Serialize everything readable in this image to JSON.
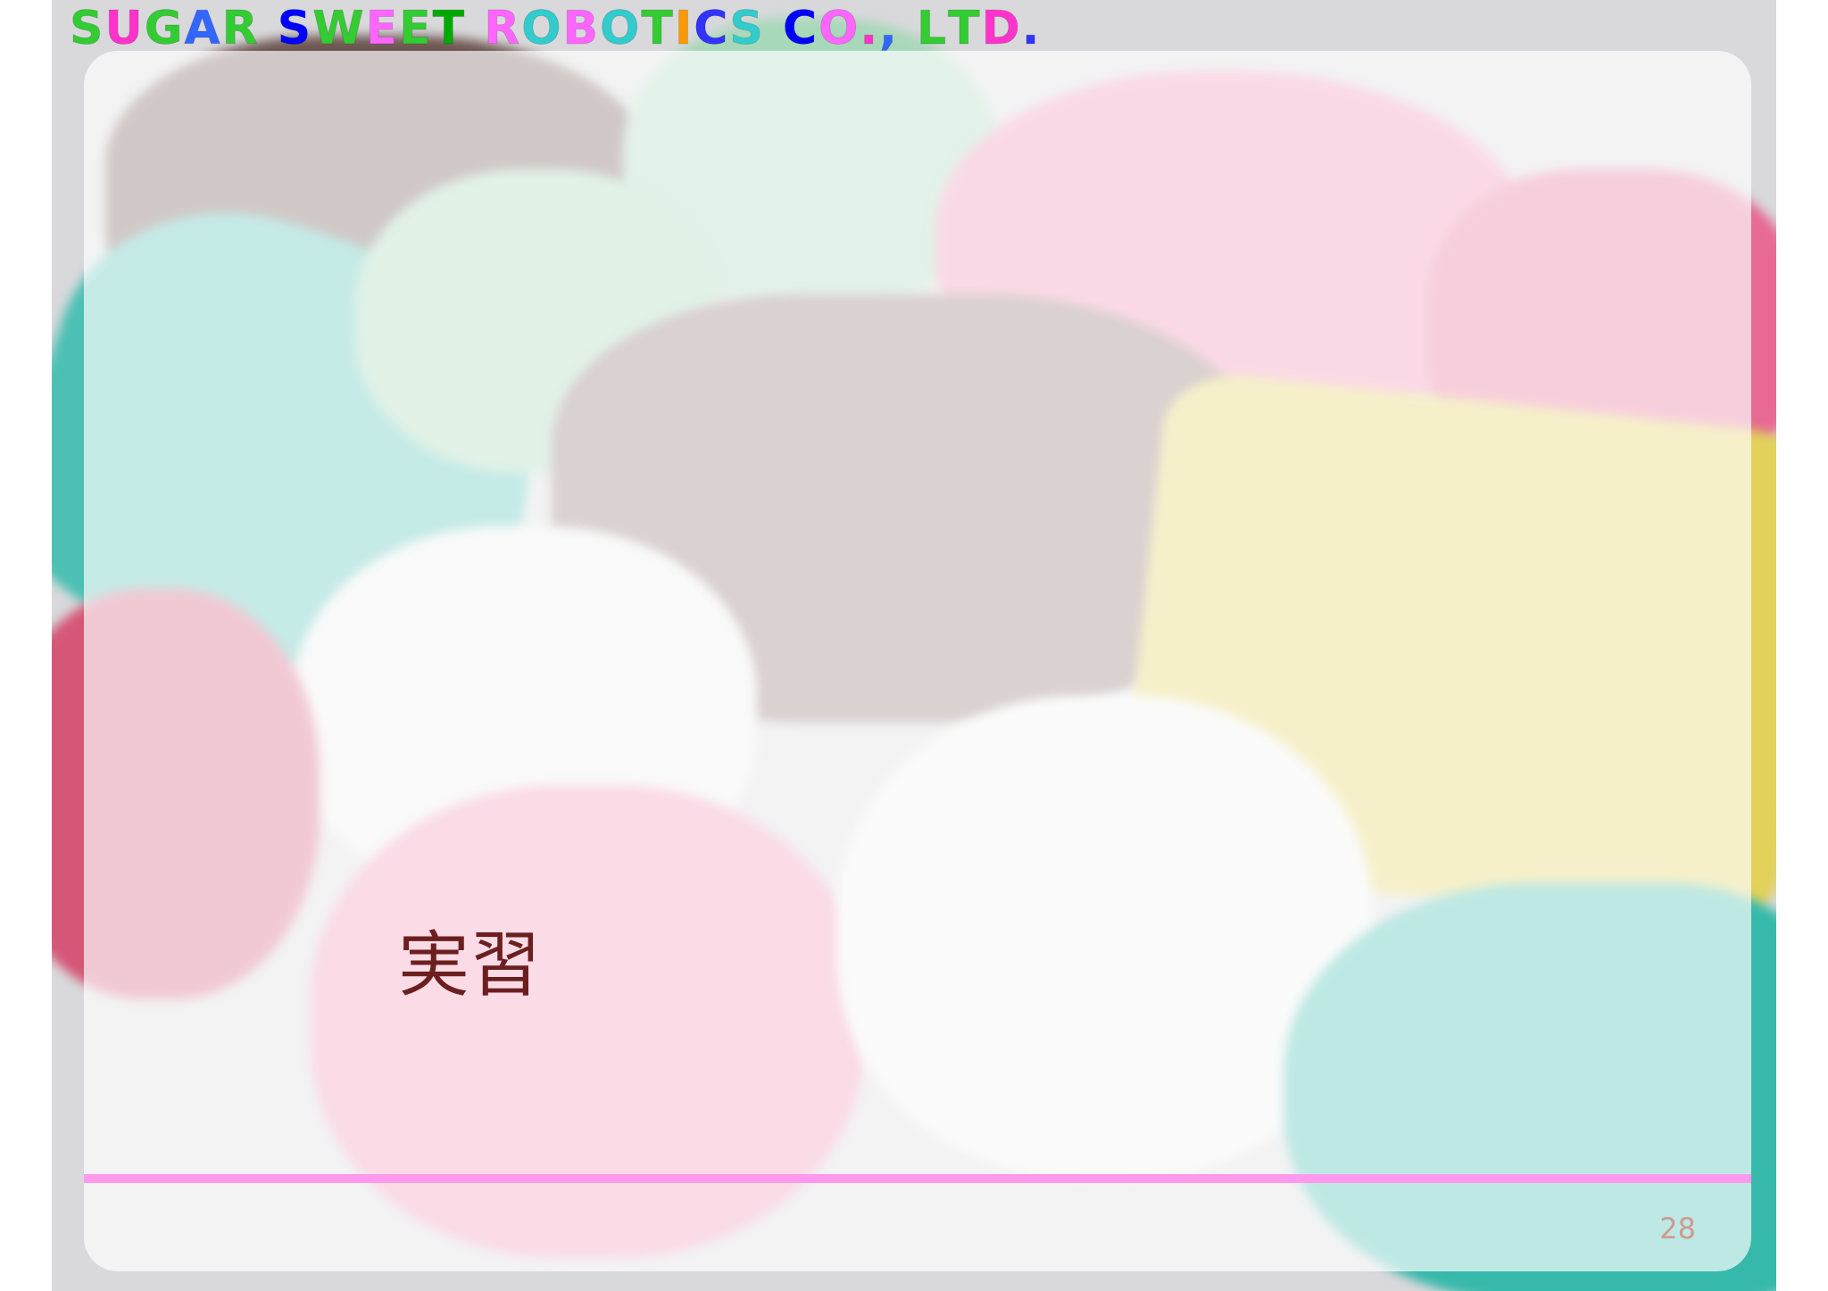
{
  "header": {
    "company_letters": [
      {
        "ch": "S",
        "color": "#33cc33"
      },
      {
        "ch": "U",
        "color": "#ff33cc"
      },
      {
        "ch": "G",
        "color": "#33cc33"
      },
      {
        "ch": "A",
        "color": "#3366ff"
      },
      {
        "ch": "R",
        "color": "#33cc33"
      },
      {
        "ch": " ",
        "color": "#000000"
      },
      {
        "ch": "S",
        "color": "#0000ff"
      },
      {
        "ch": "W",
        "color": "#33cc33"
      },
      {
        "ch": "E",
        "color": "#ff66ff"
      },
      {
        "ch": "E",
        "color": "#33cc33"
      },
      {
        "ch": "T",
        "color": "#00aa00"
      },
      {
        "ch": " ",
        "color": "#000000"
      },
      {
        "ch": "R",
        "color": "#ff66ff"
      },
      {
        "ch": "O",
        "color": "#33cccc"
      },
      {
        "ch": "B",
        "color": "#ff66ff"
      },
      {
        "ch": "O",
        "color": "#33cccc"
      },
      {
        "ch": "T",
        "color": "#33cc33"
      },
      {
        "ch": "I",
        "color": "#ff9900"
      },
      {
        "ch": "C",
        "color": "#3333ff"
      },
      {
        "ch": "S",
        "color": "#33cccc"
      },
      {
        "ch": " ",
        "color": "#000000"
      },
      {
        "ch": "C",
        "color": "#0000ff"
      },
      {
        "ch": "O",
        "color": "#ff66ff"
      },
      {
        "ch": ".",
        "color": "#ff33cc"
      },
      {
        "ch": ",",
        "color": "#3366ff"
      },
      {
        "ch": " ",
        "color": "#000000"
      },
      {
        "ch": "L",
        "color": "#33cc33"
      },
      {
        "ch": "T",
        "color": "#33cc33"
      },
      {
        "ch": "D",
        "color": "#ff33cc"
      },
      {
        "ch": ".",
        "color": "#3333ff"
      }
    ]
  },
  "slide": {
    "heading": "実習",
    "page_number": "28"
  },
  "colors": {
    "divider": "#ff99ee",
    "heading": "#6b1f1f",
    "page_number": "#cf9a90"
  }
}
